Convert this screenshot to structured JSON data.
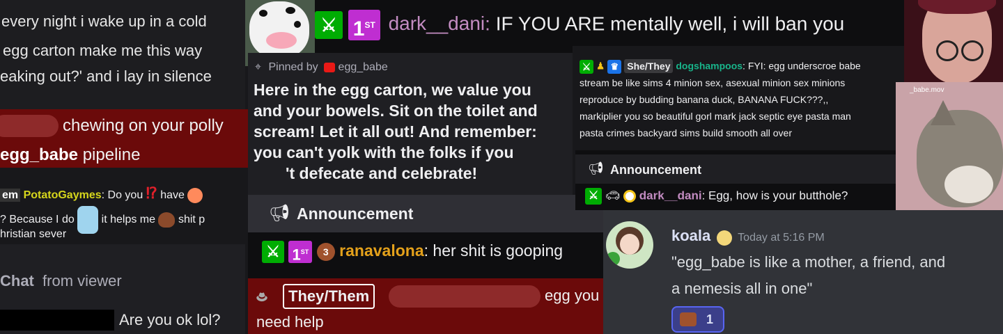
{
  "p1": {
    "lines": [
      "every night i wake up in a cold",
      "egg carton make me this way",
      "eaking out?' and i lay in silence"
    ]
  },
  "p2": {
    "after_redact": "chewing on your polly",
    "user": "egg_babe",
    "rest": "pipeline"
  },
  "p3": {
    "frag": "em",
    "user": "PotatoGaymes",
    "t1": ": Do you",
    "t2": "have",
    "line2a": "? Because I do",
    "line2b": "it helps me",
    "line2c": "shit p",
    "line3": "hristian sever"
  },
  "p4": {
    "chat": "Chat",
    "from": "from viewer",
    "msg": "Are you ok lol?"
  },
  "top": {
    "user": "dark__dani",
    "msg": "IF YOU ARE mentally well, i will ban you",
    "sub_badge": "1",
    "sub_sup": "ST"
  },
  "pinned": {
    "label": "Pinned by",
    "by": "egg_babe",
    "lines": [
      "Here in the egg carton, we value you",
      "and your bowels. Sit on the toilet and",
      "scream! Let it all out! And remember:",
      "you can't yolk with the folks if you",
      "'t defecate and celebrate!"
    ]
  },
  "ann1": {
    "title": "Announcement",
    "user": "ranavalona",
    "msg": ": her shit is gooping",
    "sub_badge": "1",
    "sub_sup": "ST",
    "gift_num": "3"
  },
  "they": {
    "pronoun": "They/Them",
    "after": "egg you",
    "line2": "need help"
  },
  "dog": {
    "pronoun": "She/They",
    "user": "dogshampoos",
    "lines": [
      ": FYI: egg underscroe babe",
      "stream be like sims 4 minion sex, asexual minion sex minions",
      "reproduce by budding banana duck, BANANA FUCK???,,",
      "markiplier you so beautiful gorl mark jack septic eye pasta man",
      "pasta crimes backyard sims build smooth all over"
    ]
  },
  "ann2": {
    "title": "Announcement",
    "user": "dark__dani",
    "msg": ": Egg, how is your butthole?"
  },
  "discord": {
    "name": "koala",
    "time": "Today at 5:16 PM",
    "lines": [
      "\"egg_babe is like a mother, a friend, and",
      "a nemesis all in one\""
    ],
    "reaction_count": "1"
  },
  "cat": {
    "caption": "_babe.mov"
  },
  "colors": {
    "red_panel": "#6b0a0a",
    "potato": "#d6d61c",
    "dani": "#c38cc2",
    "rana": "#e4a11b",
    "dog": "#18b58b",
    "discord_bg": "#313338"
  }
}
